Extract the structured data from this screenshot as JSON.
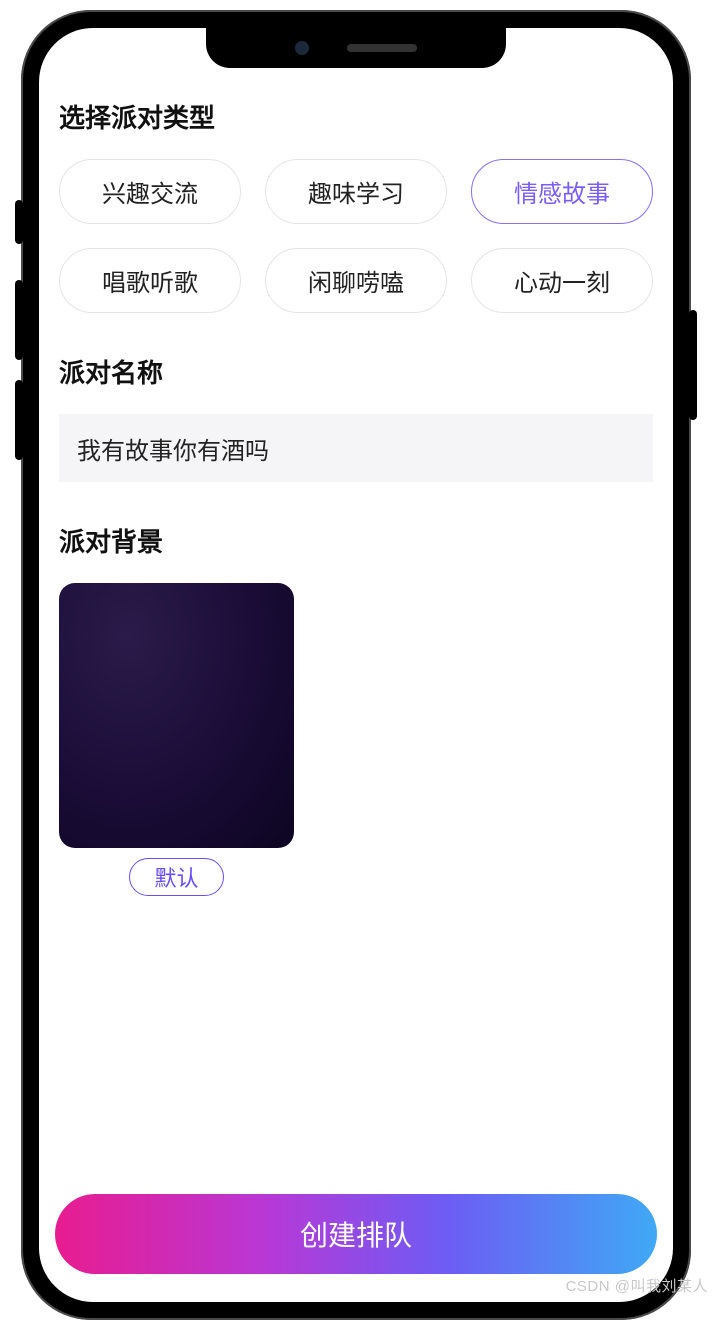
{
  "sections": {
    "type_title": "选择派对类型",
    "name_title": "派对名称",
    "bg_title": "派对背景"
  },
  "party_types": [
    {
      "label": "兴趣交流",
      "selected": false
    },
    {
      "label": "趣味学习",
      "selected": false
    },
    {
      "label": "情感故事",
      "selected": true
    },
    {
      "label": "唱歌听歌",
      "selected": false
    },
    {
      "label": "闲聊唠嗑",
      "selected": false
    },
    {
      "label": "心动一刻",
      "selected": false
    }
  ],
  "party_name": {
    "value": "我有故事你有酒吗"
  },
  "backgrounds": [
    {
      "label": "默认",
      "color": "#1a0c36"
    }
  ],
  "footer": {
    "create_label": "创建排队"
  },
  "watermark": "CSDN @叫我刘某人"
}
